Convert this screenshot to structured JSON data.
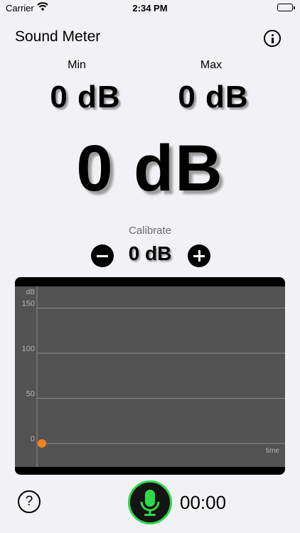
{
  "status_bar": {
    "carrier": "Carrier",
    "time": "2:34 PM"
  },
  "header": {
    "title": "Sound Meter",
    "info_icon": "info-circle-icon"
  },
  "readings": {
    "min_label": "Min",
    "min_value": "0 dB",
    "max_label": "Max",
    "max_value": "0 dB",
    "current_value": "0 dB"
  },
  "calibrate": {
    "label": "Calibrate",
    "value": "0 dB",
    "decrease_icon": "minus-circle-icon",
    "increase_icon": "plus-circle-icon"
  },
  "chart_data": {
    "type": "line",
    "ylabel": "dB",
    "xlabel": "time",
    "y_ticks": [
      0,
      50,
      100,
      150
    ],
    "ylim": [
      0,
      160
    ],
    "grid": true,
    "series": [
      {
        "x": [
          0
        ],
        "y": [
          0
        ],
        "color": "#f0821e"
      }
    ],
    "colors": {
      "background": "#525252",
      "grid": "#8a8a8a",
      "text": "#b4b4b4",
      "point": "#f0821e"
    }
  },
  "footer": {
    "help_icon": "question-circle-icon",
    "help_label": "?",
    "mic_icon": "microphone-icon",
    "timer": "00:00",
    "accent_color": "#2fd84a"
  }
}
